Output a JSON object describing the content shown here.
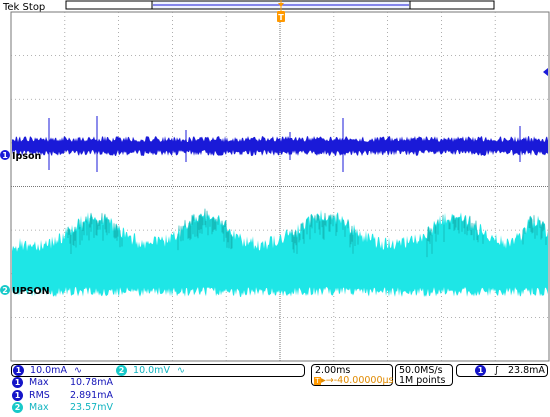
{
  "status": {
    "brand": "Tek",
    "state": "Stop"
  },
  "trigger_marker": "T",
  "channels": {
    "ch1": {
      "number": "1",
      "label": "Ipson",
      "scale": "10.0mA",
      "bw_icon": "bandwidth-limit-icon",
      "color": "#1a1ad8"
    },
    "ch2": {
      "number": "2",
      "label": "UPSON",
      "scale": "10.0mV",
      "bw_icon": "bandwidth-limit-icon",
      "color": "#1ee6e6"
    }
  },
  "measurements": [
    {
      "channel": "1",
      "name": "Max",
      "value": "10.78mA"
    },
    {
      "channel": "1",
      "name": "RMS",
      "value": "2.891mA"
    },
    {
      "channel": "2",
      "name": "Max",
      "value": "23.57mV"
    }
  ],
  "timebase": {
    "scale": "2.00ms",
    "position": "-40.00000µs"
  },
  "acquisition": {
    "rate": "50.0MS/s",
    "length": "1M points"
  },
  "trigger": {
    "channel": "1",
    "slope_icon": "rising-edge-icon",
    "level": "23.8mA"
  },
  "colors": {
    "grid": "#9a9a9a",
    "ch1": "#1a1ad8",
    "ch2": "#1ee6e6",
    "ch2_dark": "#10908f",
    "trigger": "#ff9900"
  }
}
